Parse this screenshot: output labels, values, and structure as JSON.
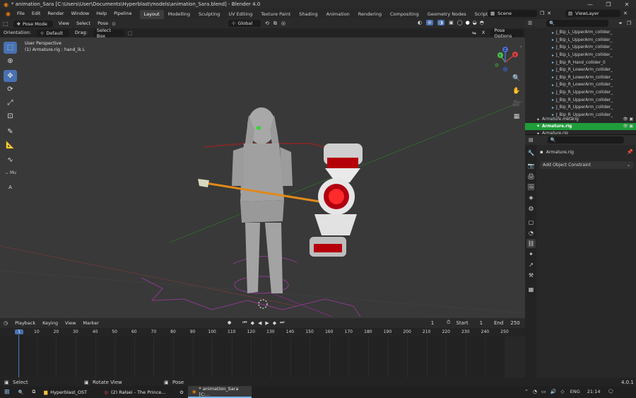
{
  "window": {
    "title": "* animation_Sara [C:\\Users\\User\\Documents\\Hyperblast\\models\\animation_Sara.blend] - Blender 4.0",
    "minimize": "—",
    "maximize": "❐",
    "close": "✕"
  },
  "menubar": {
    "menus": [
      "File",
      "Edit",
      "Render",
      "Window",
      "Help",
      "Pipeline"
    ],
    "workspaces": [
      "Layout",
      "Modelling",
      "Sculpting",
      "UV Editing",
      "Texture Paint",
      "Shading",
      "Animation",
      "Rendering",
      "Compositing",
      "Geometry Nodes",
      "Scripting"
    ],
    "add_workspace": "+",
    "scene": "Scene",
    "view_layer": "ViewLayer"
  },
  "viewport_header": {
    "mode": "Pose Mode",
    "menus": [
      "View",
      "Select",
      "Pose"
    ],
    "transform_orientation": "Global",
    "orientation_label": "Orientation:",
    "orientation_value": "Default",
    "drag_label": "Drag:",
    "drag_value": "Select Box",
    "pose_options": "Pose Options",
    "x_label": "X"
  },
  "viewport": {
    "perspective": "User Perspective",
    "selection": "(1) Armature.rig : hand_ik.L",
    "sidebar_mu": "Mu"
  },
  "gizmo": {
    "x": "X",
    "y": "Y",
    "z": "Z"
  },
  "outliner": {
    "items": [
      "J_Bip_L_UpperArm_collider_",
      "J_Bip_L_UpperArm_collider_",
      "J_Bip_L_UpperArm_collider_",
      "J_Bip_L_UpperArm_collider_",
      "J_Bip_R_Hand_collider_0",
      "J_Bip_R_LowerArm_collider_",
      "J_Bip_R_LowerArm_collider_",
      "J_Bip_R_LowerArm_collider_",
      "J_Bip_R_UpperArm_collider_",
      "J_Bip_R_UpperArm_collider_",
      "J_Bip_R_UpperArm_collider_",
      "J_Bip_R_UpperArm_collider_"
    ],
    "metarig": "Armature.metarig",
    "rig": "Armature.rig",
    "partial": "Armature.rig"
  },
  "properties": {
    "object": "Armature.rig",
    "add_constraint": "Add Object Constraint"
  },
  "timeline": {
    "menus": [
      "Playback",
      "Keying",
      "View",
      "Marker"
    ],
    "current_frame": "1",
    "start_label": "Start",
    "start": "1",
    "end_label": "End",
    "end": "250",
    "ticks": [
      "1",
      "10",
      "20",
      "30",
      "40",
      "50",
      "60",
      "70",
      "80",
      "90",
      "100",
      "110",
      "120",
      "130",
      "140",
      "150",
      "160",
      "170",
      "180",
      "190",
      "200",
      "210",
      "220",
      "230",
      "240",
      "250"
    ]
  },
  "statusbar": {
    "select": "Select",
    "rotate": "Rotate View",
    "pose": "Pose",
    "version": "4.0.1"
  },
  "taskbar": {
    "apps": [
      "Hyperblast_OST",
      "(2) Ralsei - The Prince...",
      "* animation_Sara [C:..."
    ],
    "lang": "ENG",
    "time": "21:14"
  },
  "colors": {
    "accent": "#4772b3",
    "selected_row": "#1f9d3a",
    "background": "#393939"
  }
}
